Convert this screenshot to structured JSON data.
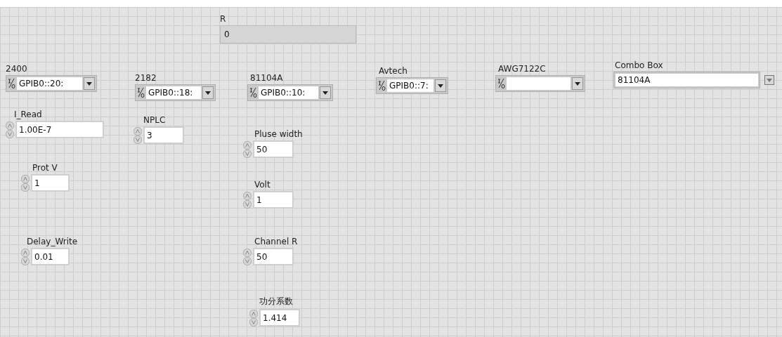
{
  "indicator": {
    "label": "R",
    "value": "0"
  },
  "controls": [
    {
      "kind": "visa",
      "label": "2400",
      "value": "GPIB0::20:"
    },
    {
      "kind": "visa",
      "label": "2182",
      "value": "GPIB0::18:"
    },
    {
      "kind": "visa",
      "label": "81104A",
      "value": "GPIB0::10:"
    },
    {
      "kind": "visa",
      "label": "Avtech",
      "value": "GPIB0::7:"
    },
    {
      "kind": "visa",
      "label": "AWG7122C"
    },
    {
      "kind": "combo",
      "label": "Combo Box",
      "value": "81104A"
    },
    {
      "kind": "numeric",
      "label": "I_Read",
      "value": "1.00E-7"
    },
    {
      "kind": "numeric",
      "label": "NPLC",
      "value": "3"
    },
    {
      "kind": "numeric",
      "label": "Pluse width",
      "value": "50"
    },
    {
      "kind": "numeric",
      "label": "Prot V",
      "value": "1"
    },
    {
      "kind": "numeric",
      "label": "Volt",
      "value": "1"
    },
    {
      "kind": "numeric",
      "label": "Delay_Write",
      "value": "0.01"
    },
    {
      "kind": "numeric",
      "label": "Channel R",
      "value": "50"
    },
    {
      "kind": "numeric",
      "label": "功分系数",
      "value": "1.414"
    }
  ]
}
